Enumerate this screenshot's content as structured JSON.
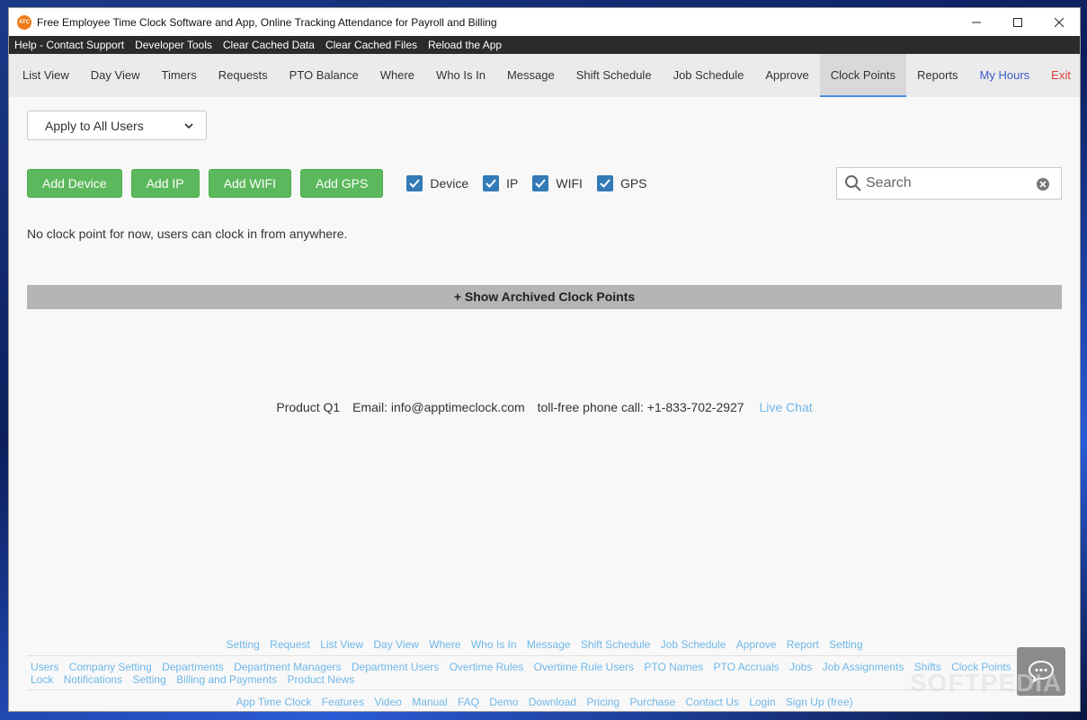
{
  "window": {
    "title": "Free Employee Time Clock Software and App, Online Tracking Attendance for Payroll and Billing",
    "logo_text": "ATC"
  },
  "menubar": {
    "items": [
      "Help - Contact Support",
      "Developer Tools",
      "Clear Cached Data",
      "Clear Cached Files",
      "Reload the App"
    ]
  },
  "nav": {
    "items": [
      {
        "label": "List View",
        "style": "normal"
      },
      {
        "label": "Day View",
        "style": "normal"
      },
      {
        "label": "Timers",
        "style": "normal"
      },
      {
        "label": "Requests",
        "style": "normal"
      },
      {
        "label": "PTO Balance",
        "style": "normal"
      },
      {
        "label": "Where",
        "style": "normal"
      },
      {
        "label": "Who Is In",
        "style": "normal"
      },
      {
        "label": "Message",
        "style": "normal"
      },
      {
        "label": "Shift Schedule",
        "style": "normal"
      },
      {
        "label": "Job Schedule",
        "style": "normal"
      },
      {
        "label": "Approve",
        "style": "normal"
      },
      {
        "label": "Clock Points",
        "style": "active"
      },
      {
        "label": "Reports",
        "style": "normal"
      },
      {
        "label": "My Hours",
        "style": "blue"
      },
      {
        "label": "Exit",
        "style": "red"
      }
    ]
  },
  "user_select": {
    "value": "Apply to All Users"
  },
  "actions": {
    "add_device": "Add Device",
    "add_ip": "Add IP",
    "add_wifi": "Add WIFI",
    "add_gps": "Add GPS"
  },
  "filters": [
    {
      "label": "Device",
      "checked": true
    },
    {
      "label": "IP",
      "checked": true
    },
    {
      "label": "WIFI",
      "checked": true
    },
    {
      "label": "GPS",
      "checked": true
    }
  ],
  "search": {
    "placeholder": "Search"
  },
  "empty_message": "No clock point for now, users can clock in from anywhere.",
  "archived_toggle": "+ Show Archived Clock Points",
  "contact": {
    "product": "Product Q1",
    "email": "Email: info@apptimeclock.com",
    "phone": "toll-free phone call: +1-833-702-2927",
    "live_chat": "Live Chat"
  },
  "footer": {
    "row1": [
      "Setting",
      "Request",
      "List View",
      "Day View",
      "Where",
      "Who Is In",
      "Message",
      "Shift Schedule",
      "Job Schedule",
      "Approve",
      "Report",
      "Setting"
    ],
    "row2": [
      "Users",
      "Company Setting",
      "Departments",
      "Department Managers",
      "Department Users",
      "Overtime Rules",
      "Overtime Rule Users",
      "PTO Names",
      "PTO Accruals",
      "Jobs",
      "Job Assignments",
      "Shifts",
      "Clock Points"
    ],
    "row3": [
      "Lock",
      "Notifications",
      "Setting",
      "Billing and Payments",
      "Product News"
    ],
    "row4": [
      "App Time Clock",
      "Features",
      "Video",
      "Manual",
      "FAQ",
      "Demo",
      "Download",
      "Pricing",
      "Purchase",
      "Contact Us",
      "Login",
      "Sign Up (free)"
    ]
  },
  "watermark": "SOFTPEDIA",
  "colors": {
    "green_button": "#5cb85c",
    "checkbox": "#337ab7",
    "link": "#6fb7e8",
    "exit": "#e03a3a",
    "my_hours": "#3b5bcc"
  }
}
